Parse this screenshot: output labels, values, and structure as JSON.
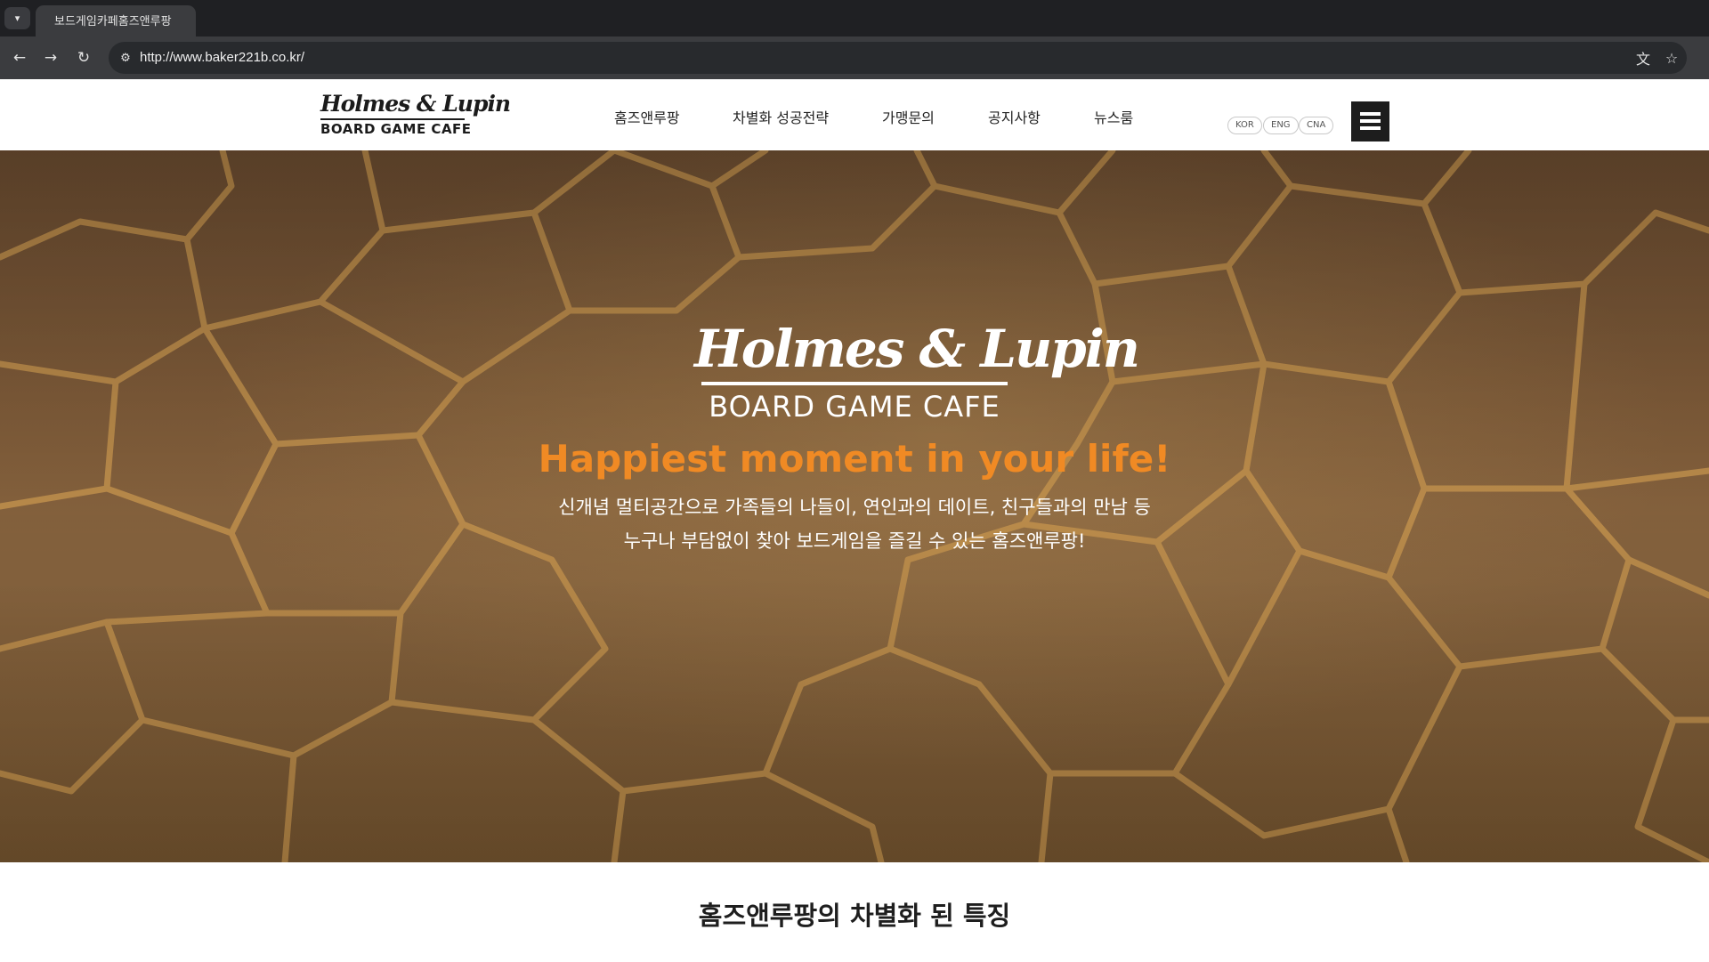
{
  "browser": {
    "tab_title": "보드게임카페홈즈앤루팡",
    "url": "http://www.baker221b.co.kr/",
    "icons": [
      "tab-list-icon",
      "back-arrow-icon",
      "forward-arrow-icon",
      "reload-icon",
      "site-info-icon",
      "translate-icon",
      "bookmark-star-icon"
    ]
  },
  "header": {
    "logo_script": "Holmes & Lupin",
    "logo_sub": "BOARD GAME CAFE",
    "nav": [
      "홈즈앤루팡",
      "차별화 성공전략",
      "가맹문의",
      "공지사항",
      "뉴스룸"
    ],
    "languages": [
      "KOR",
      "ENG",
      "CNA"
    ],
    "menu_icon": "hamburger-menu-icon"
  },
  "hero": {
    "logo_script": "Holmes & Lupin",
    "logo_sub": "BOARD GAME CAFE",
    "tagline": "Happiest moment in your life!",
    "desc_line1": "신개념 멀티공간으로 가족들의 나들이, 연인과의 데이트, 친구들과의 만남 등",
    "desc_line2": "누구나 부담없이 찾아 보드게임을 즐길 수 있는 홈즈앤루팡!"
  },
  "section": {
    "title": "홈즈앤루팡의 차별화 된 특징"
  },
  "colors": {
    "accent": "#f08a24",
    "hero_base": "#7d5a38",
    "menu_button": "#1d1d1d"
  }
}
